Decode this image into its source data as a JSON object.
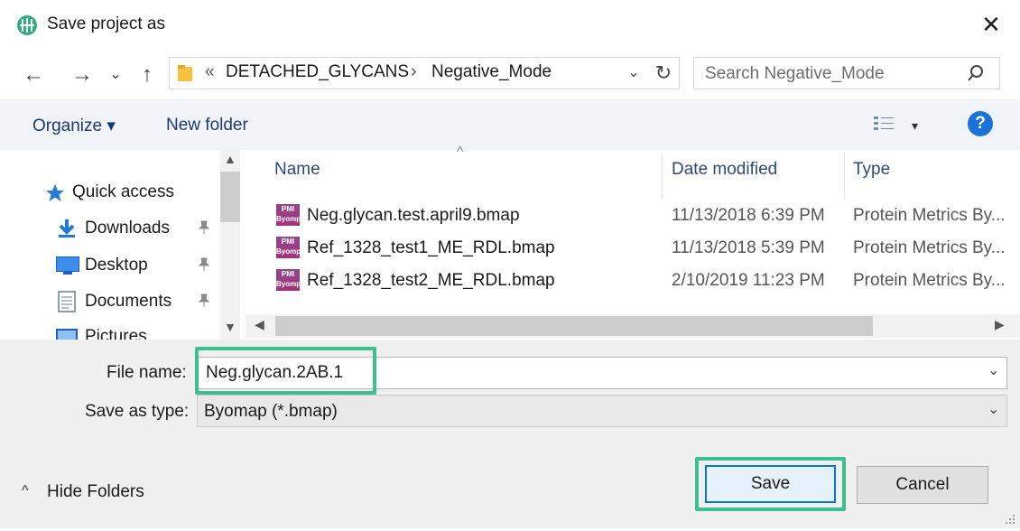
{
  "window": {
    "title": "Save project as",
    "close_glyph": "✕"
  },
  "nav": {
    "back_glyph": "←",
    "forward_glyph": "→",
    "recent_glyph": "⌄",
    "up_glyph": "↑",
    "breadcrumb_prefix": "«",
    "breadcrumbs": [
      "DETACHED_GLYCANS",
      "Negative_Mode"
    ],
    "crumb_sep": "›",
    "dropdown_glyph": "⌄",
    "refresh_glyph": "↻"
  },
  "search": {
    "placeholder": "Search Negative_Mode"
  },
  "toolbar": {
    "organize_label": "Organize ▾",
    "new_folder_label": "New folder",
    "view_glyph": "▾",
    "help_label": "?"
  },
  "sidebar": {
    "items": [
      {
        "label": "Quick access",
        "icon": "star-icon"
      },
      {
        "label": "Downloads",
        "icon": "download-arrow-icon",
        "pinned": true
      },
      {
        "label": "Desktop",
        "icon": "desktop-icon",
        "pinned": true
      },
      {
        "label": "Documents",
        "icon": "documents-icon",
        "pinned": true
      },
      {
        "label": "Pictures",
        "icon": "pictures-icon",
        "pinned": true
      }
    ],
    "pin_glyph": "📌"
  },
  "file_list": {
    "sort_glyph": "^",
    "columns": [
      "Name",
      "Date modified",
      "Type"
    ],
    "rows": [
      {
        "name": "Neg.glycan.test.april9.bmap",
        "date": "11/13/2018 6:39 PM",
        "type": "Protein Metrics By..."
      },
      {
        "name": "Ref_1328_test1_ME_RDL.bmap",
        "date": "11/13/2018 5:39 PM",
        "type": "Protein Metrics By..."
      },
      {
        "name": "Ref_1328_test2_ME_RDL.bmap",
        "date": "2/10/2019 11:23 PM",
        "type": "Protein Metrics By..."
      }
    ],
    "icon_text_top": "PMI",
    "icon_text_bottom": "Byomp"
  },
  "form": {
    "file_name_label": "File name:",
    "file_name_value": "Neg.glycan.2AB.1",
    "save_type_label": "Save as type:",
    "save_type_value": "Byomap (*.bmap)",
    "combo_glyph": "⌄"
  },
  "footer": {
    "hide_folders_label": "Hide Folders",
    "hide_glyph": "^",
    "save_label": "Save",
    "cancel_label": "Cancel"
  },
  "colors": {
    "highlight": "#3dbf8f",
    "accent": "#0078d7"
  }
}
